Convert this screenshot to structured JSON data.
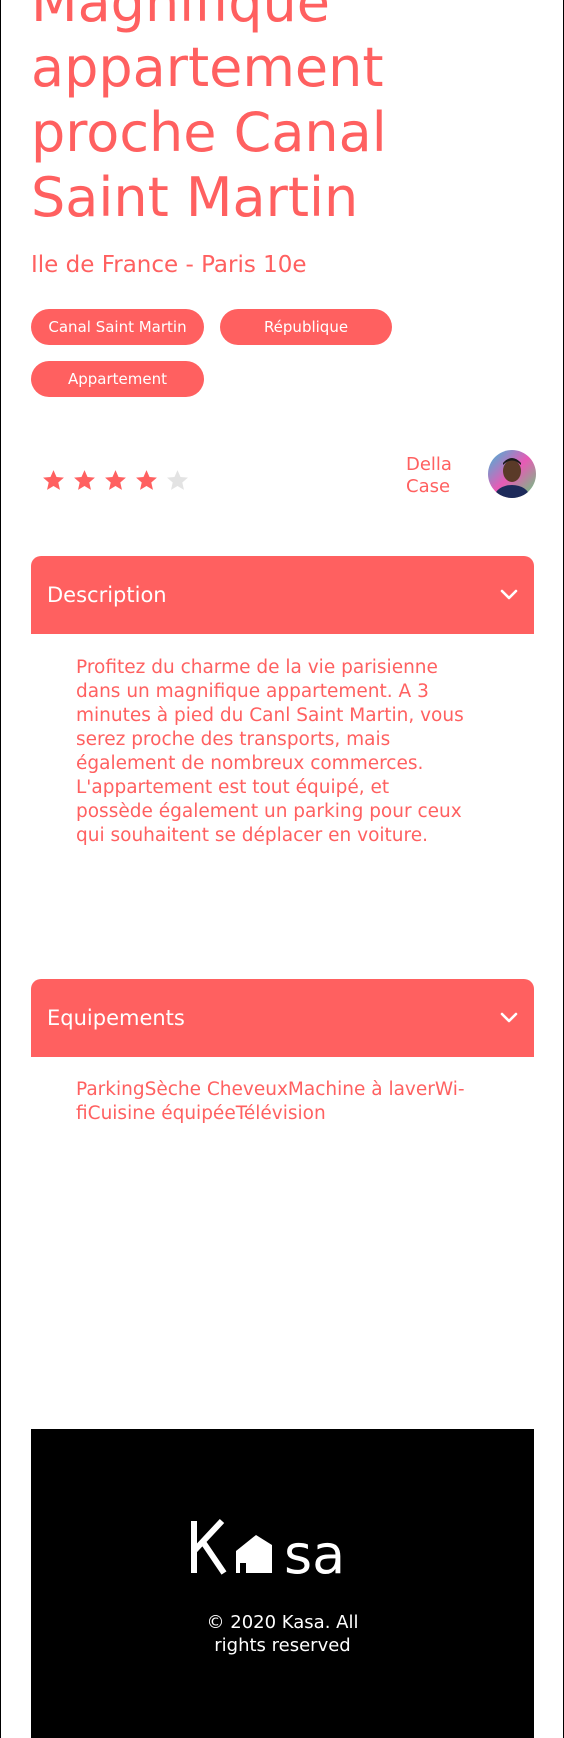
{
  "listing": {
    "title": "Magnifique appartement proche Canal Saint Martin",
    "location": "Ile de France - Paris 10e",
    "tags": [
      "Canal Saint Martin",
      "République",
      "Appartement"
    ],
    "rating": 4,
    "rating_max": 5
  },
  "host": {
    "first_name": "Della",
    "last_name": "Case"
  },
  "description": {
    "label": "Description",
    "icon": "chevron-down-icon",
    "text": "Profitez du charme de la vie parisienne dans un magnifique appartement. A 3 minutes à pied du Canl Saint Martin, vous serez proche des transports, mais également de nombreux commerces. L'appartement est tout équipé, et possède également un parking pour ceux qui souhaitent se déplacer en voiture."
  },
  "equipments": {
    "label": "Equipements",
    "icon": "chevron-down-icon",
    "text": "ParkingSèche CheveuxMachine à laverWi-fiCuisine équipéeTélévision"
  },
  "footer": {
    "logo_text": "Kasa",
    "copyright_line1": "© 2020 Kasa. All",
    "copyright_line2": "rights reserved"
  },
  "colors": {
    "accent": "#FF6060",
    "star_empty": "#E3E3E3",
    "footer_bg": "#000000"
  }
}
